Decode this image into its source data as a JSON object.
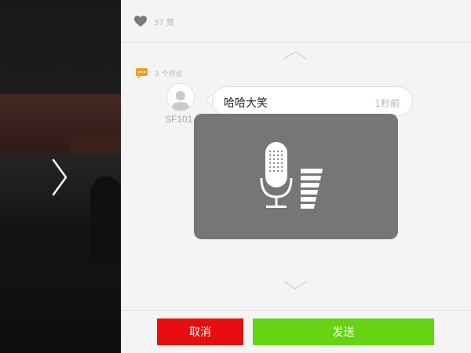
{
  "photo": {
    "next_icon": "chevron-right-icon"
  },
  "likes": {
    "icon": "heart-icon",
    "count_text": "37 赞",
    "color": "#7a7a7a"
  },
  "comments": {
    "icon": "speech-bubble-icon",
    "header_text": "3 个评论",
    "accent": "#f39c1c",
    "items": [
      {
        "user": "SF101",
        "text": "哈哈大笑",
        "time": "1秒前"
      }
    ]
  },
  "nav": {
    "scroll_up_icon": "chevron-up-icon",
    "scroll_down_icon": "chevron-down-icon"
  },
  "voice_overlay": {
    "mic_icon": "microphone-icon",
    "volume_icon": "volume-level-icon",
    "background": "#707070"
  },
  "actions": {
    "cancel_label": "取消",
    "send_label": "发送",
    "cancel_color": "#e60e0e",
    "send_color": "#66d413"
  }
}
